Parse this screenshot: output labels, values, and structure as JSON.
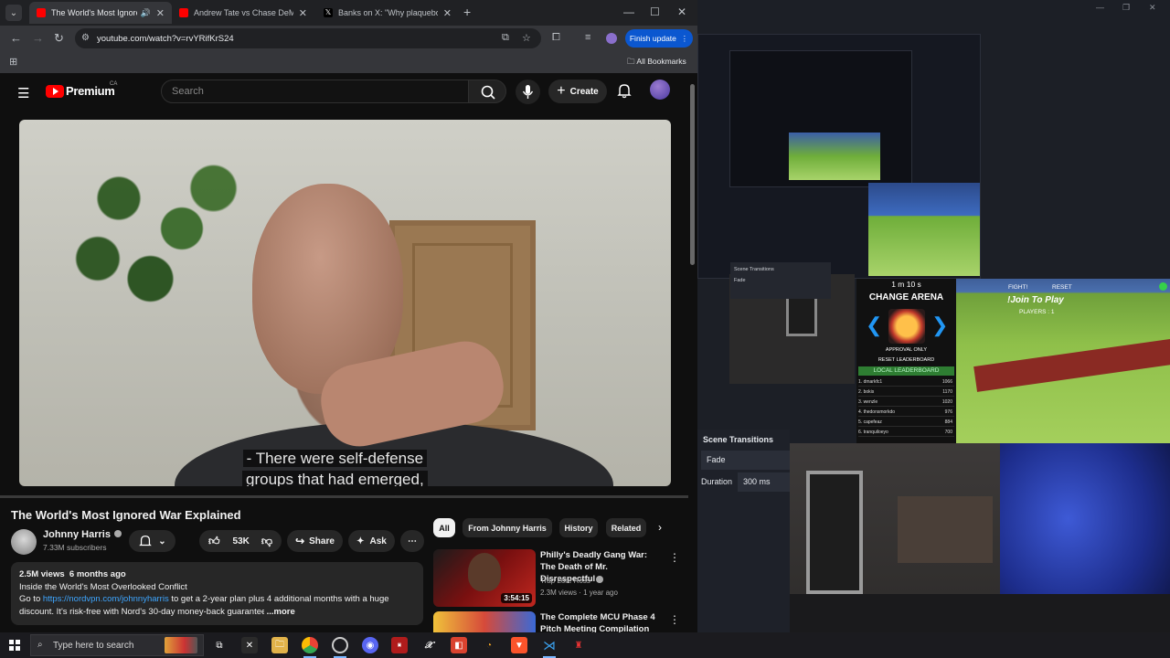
{
  "browser": {
    "tabs": [
      {
        "title": "The World's Most Ignored W",
        "active": true,
        "has_audio": true
      },
      {
        "title": "Andrew Tate vs Chase DeMoor",
        "active": false
      },
      {
        "title": "Banks on X: \"Why plaqueboym",
        "active": false
      }
    ],
    "url": "youtube.com/watch?v=rvYRifKrS24",
    "finish_update_label": "Finish update",
    "all_bookmarks_label": "All Bookmarks"
  },
  "youtube": {
    "logo_text": "Premium",
    "region": "CA",
    "search_placeholder": "Search",
    "create_label": "Create",
    "subtitle_line1": "- There were self-defense",
    "subtitle_line2": "groups that had emerged,",
    "video_title": "The World's Most Ignored War Explained",
    "channel_name": "Johnny Harris",
    "subscribers": "7.33M subscribers",
    "likes": "53K",
    "share_label": "Share",
    "ask_label": "Ask",
    "description": {
      "stats": "2.5M views  6 months ago",
      "line1": "Inside the World's Most Overlooked Conflict",
      "line2_prefix": "Go to ",
      "line2_link": "https://nordvpn.com/johnnyharris",
      "line2_suffix": " to get a 2-year plan plus 4 additional months with a huge",
      "line3": "discount. It's risk-free with Nord's 30-day money-back guarantee!",
      "more": "...more"
    },
    "chips": [
      "All",
      "From Johnny Harris",
      "History",
      "Related"
    ],
    "recommendations": [
      {
        "title": "Philly's Deadly Gang War: The Death of Mr. Disrespectful",
        "channel": "Trap Lore Ross",
        "meta": "2.3M views · 1 year ago",
        "duration": "3:54:15"
      },
      {
        "title": "The Complete MCU Phase 4 Pitch Meeting Compilation",
        "channel": "",
        "meta": "",
        "duration": ""
      }
    ]
  },
  "obs": {
    "arena_timer": "1 m 10 s",
    "arena_title": "CHANGE ARENA",
    "approval_only": "APPROVAL ONLY",
    "reset_leaderboard": "RESET LEADERBOARD",
    "local_leaderboard": "LOCAL LEADERBOARD",
    "leaderboard": [
      {
        "rank": "1.",
        "name": "dmarkfc1",
        "score": "1066"
      },
      {
        "rank": "2.",
        "name": "bokis",
        "score": "1170"
      },
      {
        "rank": "3.",
        "name": "wenzle",
        "score": "1020"
      },
      {
        "rank": "4.",
        "name": "thedonsmorkdo",
        "score": "976"
      },
      {
        "rank": "5.",
        "name": "capefeaz",
        "score": "884"
      },
      {
        "rank": "6.",
        "name": "tranquiloeyo",
        "score": "700"
      }
    ],
    "fight_label": "FIGHT!",
    "reset_label": "RESET",
    "join_label": "!Join To Play",
    "players_label": "PLAYERS : 1",
    "scene_transitions_title": "Scene Transitions",
    "transition_value": "Fade",
    "duration_label": "Duration",
    "duration_value": "300 ms"
  },
  "taskbar": {
    "search_placeholder": "Type here to search"
  },
  "colors": {
    "yt_red": "#ff0000",
    "finish_update_blue": "#0b57d0",
    "link_blue": "#3ea6ff",
    "leaderboard_green": "#2e7d32"
  }
}
